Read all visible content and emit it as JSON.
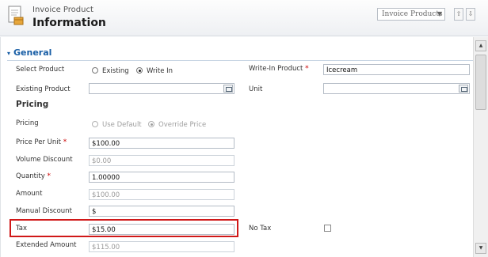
{
  "header": {
    "entity_type": "Invoice Product",
    "title": "Information",
    "form_selector": "Invoice Products",
    "up_glyph": "⇧",
    "down_glyph": "⇩",
    "caret": "▼"
  },
  "section": {
    "title": "General",
    "toggle": "▾"
  },
  "product": {
    "select_label": "Select Product",
    "options": [
      "Existing",
      "Write In"
    ],
    "selected": "Write In",
    "writein_label": "Write-In Product",
    "writein_value": "Icecream",
    "existing_label": "Existing Product",
    "existing_value": "",
    "unit_label": "Unit",
    "unit_value": ""
  },
  "pricing": {
    "heading": "Pricing",
    "pricing_label": "Pricing",
    "pricing_options": [
      "Use Default",
      "Override Price"
    ],
    "pricing_selected": "Override Price",
    "price_per_unit_label": "Price Per Unit",
    "price_per_unit": "$100.00",
    "volume_discount_label": "Volume Discount",
    "volume_discount": "$0.00",
    "quantity_label": "Quantity",
    "quantity": "1.00000",
    "amount_label": "Amount",
    "amount": "$100.00",
    "manual_discount_label": "Manual Discount",
    "manual_discount": "$",
    "tax_label": "Tax",
    "tax": "$15.00",
    "no_tax_label": "No Tax",
    "no_tax_checked": false,
    "extended_amount_label": "Extended Amount",
    "extended_amount": "$115.00"
  },
  "required_marker": "*",
  "colors": {
    "accent": "#1a5fa6",
    "required": "#cc0000",
    "highlight": "#d01818"
  },
  "icons": [
    "invoice-product-icon",
    "lookup-icon",
    "scroll-up-icon",
    "scroll-down-icon"
  ]
}
